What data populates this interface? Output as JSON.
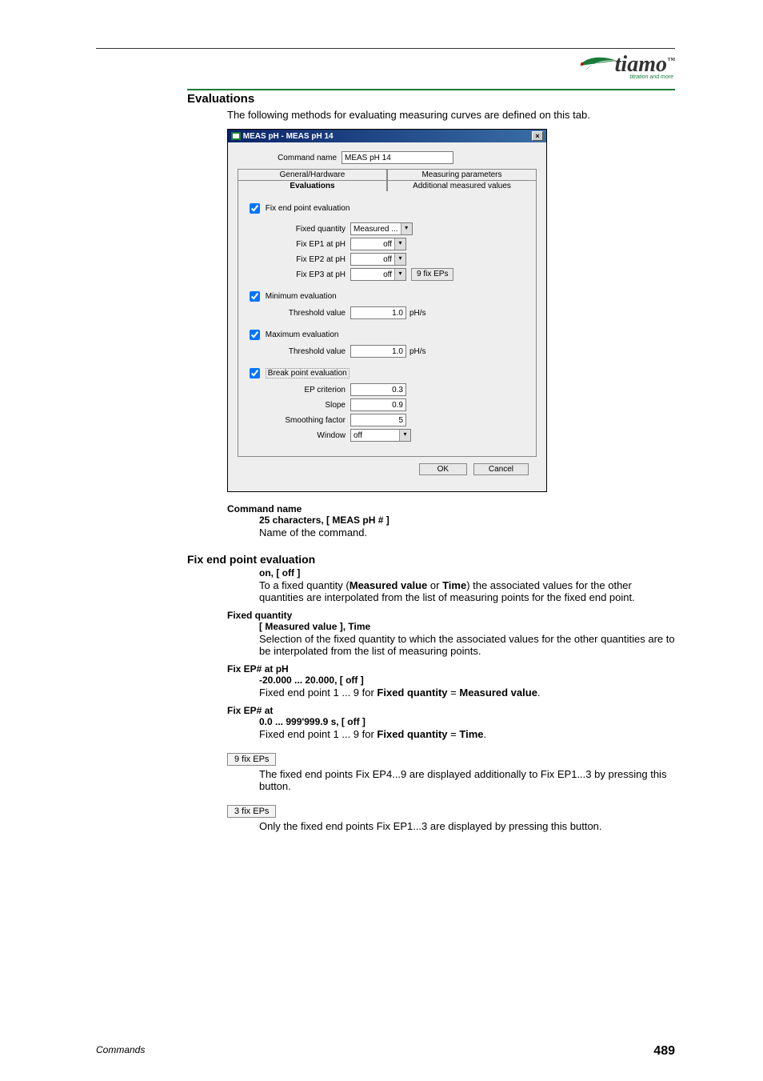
{
  "logo": {
    "name": "tiamo",
    "tagline": "titration and more",
    "tm": "™"
  },
  "section_title": "Evaluations",
  "intro": "The following methods for evaluating measuring curves are defined on this tab.",
  "dialog": {
    "title": "MEAS pH - MEAS pH 14",
    "command_name_label": "Command name",
    "command_name_value": "MEAS pH 14",
    "tabs": {
      "general": "General/Hardware",
      "measparams": "Measuring parameters",
      "evaluations": "Evaluations",
      "additional": "Additional measured values"
    },
    "fixep": {
      "chk": "Fix end point evaluation",
      "fixed_qty_label": "Fixed quantity",
      "fixed_qty_value": "Measured ...",
      "ep1_label": "Fix EP1 at pH",
      "ep1_value": "off",
      "ep2_label": "Fix EP2 at pH",
      "ep2_value": "off",
      "ep3_label": "Fix EP3 at pH",
      "ep3_value": "off",
      "more_btn": "9 fix EPs"
    },
    "min": {
      "chk": "Minimum evaluation",
      "thresh_label": "Threshold value",
      "thresh_value": "1.0",
      "unit": "pH/s"
    },
    "max": {
      "chk": "Maximum evaluation",
      "thresh_label": "Threshold value",
      "thresh_value": "1.0",
      "unit": "pH/s"
    },
    "bp": {
      "chk": "Break point evaluation",
      "epcrit_label": "EP criterion",
      "epcrit_value": "0.3",
      "slope_label": "Slope",
      "slope_value": "0.9",
      "smooth_label": "Smoothing factor",
      "smooth_value": "5",
      "window_label": "Window",
      "window_value": "off"
    },
    "ok": "OK",
    "cancel": "Cancel"
  },
  "params": {
    "cmdname": {
      "title": "Command name",
      "range": "25 characters, [ MEAS pH # ]",
      "desc": "Name of the command."
    },
    "fixep_heading": "Fix end point evaluation",
    "fixep_onoff": {
      "range": "on, [ off ]",
      "desc1": "To a fixed quantity (",
      "b1": "Measured value",
      "mid": " or ",
      "b2": "Time",
      "desc2": ") the associated values for the other quantities are interpolated from the list of measuring points for the fixed end point."
    },
    "fixedqty": {
      "title": "Fixed quantity",
      "range": "[ Measured value ], Time",
      "desc": "Selection of the fixed quantity to which the associated values for the other quantities are to be interpolated from the list of measuring points."
    },
    "fixep_ph": {
      "title": "Fix EP# at pH",
      "range": "-20.000 ... 20.000, [ off ]",
      "desc1": "Fixed end point 1 ... 9 for ",
      "b1": "Fixed quantity",
      "eq": " = ",
      "b2": "Measured value",
      "period": "."
    },
    "fixep_at": {
      "title": "Fix EP# at",
      "range": "0.0 ... 999'999.9 s, [ off ]",
      "desc1": "Fixed end point 1 ... 9 for ",
      "b1": "Fixed quantity",
      "eq": " = ",
      "b2": "Time",
      "period": "."
    },
    "btn9": {
      "label": "9 fix EPs",
      "desc": "The fixed end points Fix EP4...9 are displayed additionally to Fix EP1...3 by pressing this button."
    },
    "btn3": {
      "label": "3 fix EPs",
      "desc": "Only the fixed end points Fix EP1...3 are displayed by pressing this button."
    }
  },
  "footer": {
    "left": "Commands",
    "right": "489"
  }
}
